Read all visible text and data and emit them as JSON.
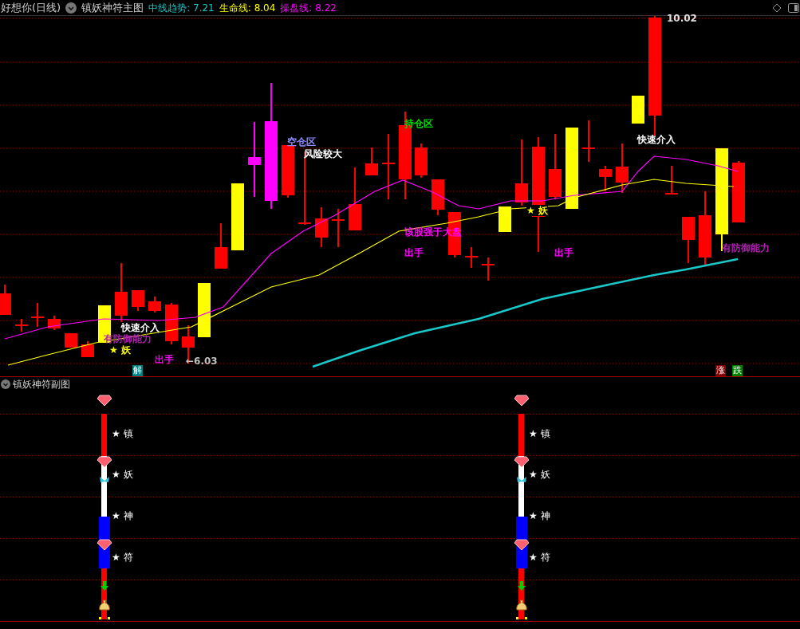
{
  "header": {
    "stock": "好想你(日线)",
    "indicator": "镇妖神符主图",
    "values": [
      {
        "label": "中线趋势:",
        "value": "7.21",
        "color": "#19c8c8"
      },
      {
        "label": "生命线:",
        "value": "8.04",
        "color": "#ffff00"
      },
      {
        "label": "操盘线:",
        "value": "8.22",
        "color": "#ff00ff"
      }
    ]
  },
  "main_chart": {
    "annotations": [
      {
        "text": "10.02",
        "color": "#e0e0e0"
      },
      {
        "text": "空仓区",
        "color": "#8c8cff"
      },
      {
        "text": "风险较大",
        "color": "#ffffff"
      },
      {
        "text": "持仓区",
        "color": "#00e000"
      },
      {
        "text": "快速介入",
        "color": "#ffffff"
      },
      {
        "text": "该股强于大盘",
        "color": "#ff00ff"
      },
      {
        "text": "出手",
        "color": "#ff00ff"
      },
      {
        "text": "★ 妖",
        "color": "#ffff00"
      },
      {
        "text": "出手",
        "color": "#ff00ff"
      },
      {
        "text": "有防御能力",
        "color": "#b020b0"
      },
      {
        "text": "快速介入",
        "color": "#ffffff"
      },
      {
        "text": "有防御能力",
        "color": "#b020b0"
      },
      {
        "text": "★ 妖",
        "color": "#ffff00"
      },
      {
        "text": "出手",
        "color": "#ff00ff"
      },
      {
        "text": "←6.03",
        "color": "#c0c0c0"
      }
    ],
    "tags": [
      {
        "text": "解",
        "color": "#008080"
      },
      {
        "text": "涨",
        "color": "#800000"
      },
      {
        "text": "跌",
        "color": "#008000"
      }
    ]
  },
  "sub_chart": {
    "title": "镇妖神符副图",
    "columns": [
      {
        "labels": [
          "★ 镇",
          "★ 妖",
          "★ 神",
          "★ 符"
        ]
      },
      {
        "labels": [
          "★ 镇",
          "★ 妖",
          "★ 神",
          "★ 符"
        ]
      }
    ]
  }
}
